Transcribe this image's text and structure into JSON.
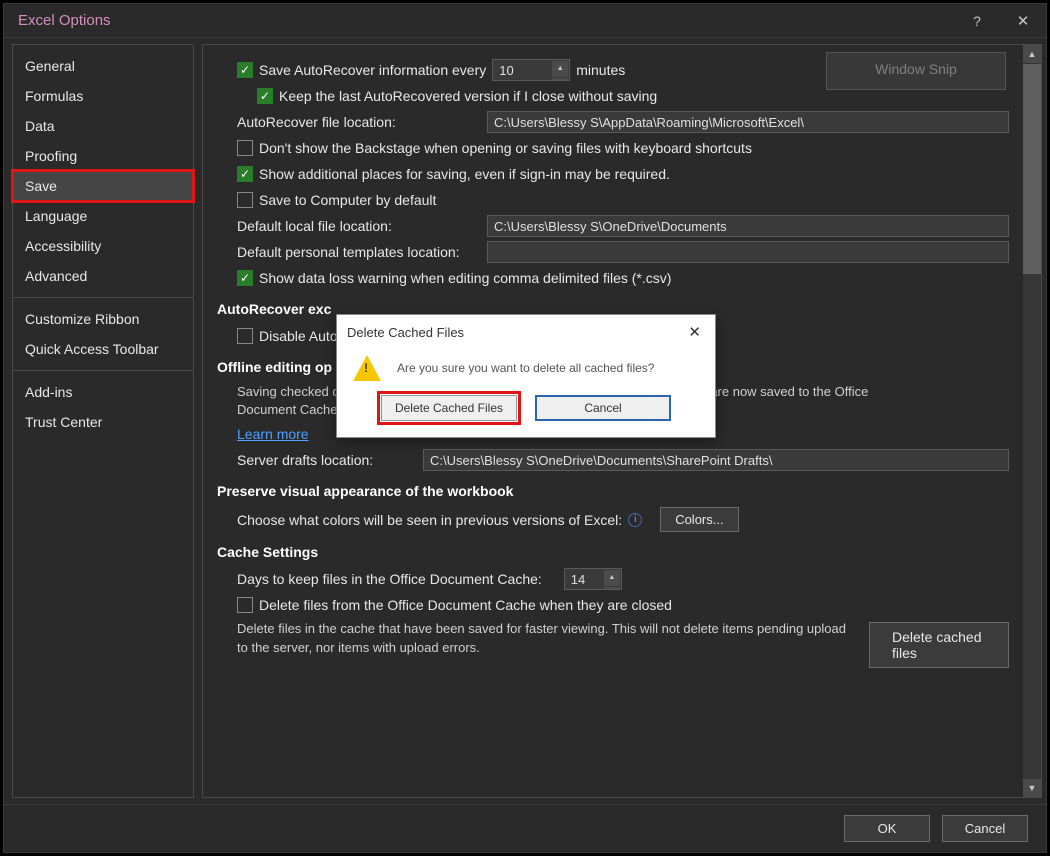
{
  "title": "Excel Options",
  "sidebar": {
    "group1": [
      "General",
      "Formulas",
      "Data",
      "Proofing",
      "Save",
      "Language",
      "Accessibility",
      "Advanced"
    ],
    "group2": [
      "Customize Ribbon",
      "Quick Access Toolbar"
    ],
    "group3": [
      "Add-ins",
      "Trust Center"
    ],
    "selected": "Save"
  },
  "snip_label": "Window Snip",
  "save": {
    "autorecover_chk": "Save AutoRecover information every",
    "autorecover_value": "10",
    "minutes": "minutes",
    "keep_last": "Keep the last AutoRecovered version if I close without saving",
    "ar_loc_label": "AutoRecover file location:",
    "ar_loc_value": "C:\\Users\\Blessy S\\AppData\\Roaming\\Microsoft\\Excel\\",
    "no_backstage": "Don't show the Backstage when opening or saving files with keyboard shortcuts",
    "additional_places": "Show additional places for saving, even if sign-in may be required.",
    "save_to_computer": "Save to Computer by default",
    "def_local_label": "Default local file location:",
    "def_local_value": "C:\\Users\\Blessy S\\OneDrive\\Documents",
    "def_templates_label": "Default personal templates location:",
    "def_templates_value": "",
    "csv_warn": "Show data loss warning when editing comma delimited files (*.csv)"
  },
  "sections": {
    "ar_except": "AutoRecover exc",
    "disable_ar": "Disable Auto",
    "offline": "Offline editing op",
    "offline_note": "Saving checked out files to server drafts is no longer supported. Checked out files are now saved to the Office Document Cache.",
    "learn_more": "Learn more",
    "server_drafts_label": "Server drafts location:",
    "server_drafts_value": "C:\\Users\\Blessy S\\OneDrive\\Documents\\SharePoint Drafts\\",
    "preserve": "Preserve visual appearance of the workbook",
    "choose_colors": "Choose what colors will be seen in previous versions of Excel:",
    "colors_btn": "Colors...",
    "cache": "Cache Settings",
    "days_label": "Days to keep files in the Office Document Cache:",
    "days_value": "14",
    "delete_on_close": "Delete files from the Office Document Cache when they are closed",
    "cache_note": "Delete files in the cache that have been saved for faster viewing. This will not delete items pending upload to the server, nor items with upload errors.",
    "delete_cached_btn": "Delete cached files"
  },
  "footer": {
    "ok": "OK",
    "cancel": "Cancel"
  },
  "dialog": {
    "title": "Delete Cached Files",
    "message": "Are you sure you want to delete all cached files?",
    "confirm": "Delete Cached Files",
    "cancel": "Cancel"
  }
}
